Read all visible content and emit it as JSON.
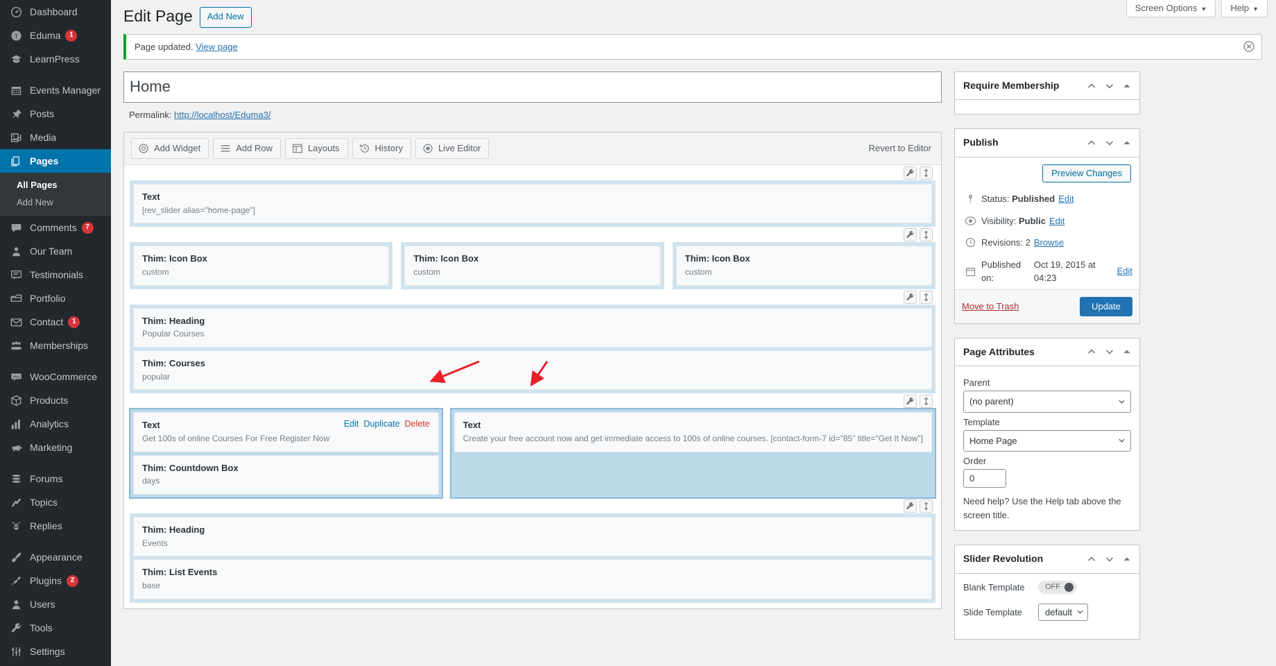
{
  "colors": {
    "accent": "#2271b1",
    "sidebar_bg": "#23282d",
    "current_menu": "#0073aa",
    "badge": "#d63638",
    "notice_green": "#00a32a",
    "delete_red": "#dc3232",
    "cell_blue": "#cfe3ef"
  },
  "sidebar": {
    "items": [
      {
        "label": "Dashboard",
        "icon": "dashboard-icon",
        "badge": ""
      },
      {
        "label": "Eduma",
        "icon": "eduma-icon",
        "badge": "1"
      },
      {
        "label": "LearnPress",
        "icon": "graduation-cap-icon",
        "badge": ""
      },
      {
        "separator": true
      },
      {
        "label": "Events Manager",
        "icon": "calendar-icon",
        "badge": ""
      },
      {
        "label": "Posts",
        "icon": "pin-icon",
        "badge": ""
      },
      {
        "label": "Media",
        "icon": "media-icon",
        "badge": ""
      },
      {
        "label": "Pages",
        "icon": "pages-icon",
        "badge": "",
        "current": true,
        "submenu": [
          {
            "label": "All Pages",
            "current": true
          },
          {
            "label": "Add New",
            "current": false
          }
        ]
      },
      {
        "label": "Comments",
        "icon": "comment-icon",
        "badge": "7"
      },
      {
        "label": "Our Team",
        "icon": "person-icon",
        "badge": ""
      },
      {
        "label": "Testimonials",
        "icon": "testimonial-icon",
        "badge": ""
      },
      {
        "label": "Portfolio",
        "icon": "portfolio-icon",
        "badge": ""
      },
      {
        "label": "Contact",
        "icon": "envelope-icon",
        "badge": "1"
      },
      {
        "label": "Memberships",
        "icon": "groups-icon",
        "badge": ""
      },
      {
        "separator": true
      },
      {
        "label": "WooCommerce",
        "icon": "woocommerce-icon",
        "badge": ""
      },
      {
        "label": "Products",
        "icon": "box-icon",
        "badge": ""
      },
      {
        "label": "Analytics",
        "icon": "chart-bar-icon",
        "badge": ""
      },
      {
        "label": "Marketing",
        "icon": "megaphone-icon",
        "badge": ""
      },
      {
        "separator": true
      },
      {
        "label": "Forums",
        "icon": "forums-icon",
        "badge": ""
      },
      {
        "label": "Topics",
        "icon": "topics-icon",
        "badge": ""
      },
      {
        "label": "Replies",
        "icon": "replies-icon",
        "badge": ""
      },
      {
        "separator": true
      },
      {
        "label": "Appearance",
        "icon": "paintbrush-icon",
        "badge": ""
      },
      {
        "label": "Plugins",
        "icon": "plug-icon",
        "badge": "2"
      },
      {
        "label": "Users",
        "icon": "users-icon",
        "badge": ""
      },
      {
        "label": "Tools",
        "icon": "wrench-icon",
        "badge": ""
      },
      {
        "label": "Settings",
        "icon": "settings-icon",
        "badge": ""
      }
    ]
  },
  "screen_meta": {
    "screen_options": "Screen Options",
    "help": "Help",
    "caret": "▼"
  },
  "header": {
    "title": "Edit Page",
    "add_new": "Add New"
  },
  "notice": {
    "text": "Page updated.",
    "link": "View page"
  },
  "post": {
    "title_value": "Home",
    "permalink_label": "Permalink:",
    "permalink_url": "http://localhost/Eduma3/"
  },
  "builder": {
    "toolbar": [
      {
        "label": "Add Widget",
        "icon": "add-widget-icon"
      },
      {
        "label": "Add Row",
        "icon": "add-row-icon"
      },
      {
        "label": "Layouts",
        "icon": "layouts-icon"
      },
      {
        "label": "History",
        "icon": "history-icon"
      },
      {
        "label": "Live Editor",
        "icon": "live-editor-icon"
      }
    ],
    "revert_label": "Revert to Editor",
    "widget_actions": {
      "edit": "Edit",
      "duplicate": "Duplicate",
      "delete": "Delete"
    },
    "rows": [
      {
        "cells": [
          {
            "widgets": [
              {
                "title": "Text",
                "desc": "[rev_slider alias=\"home-page\"]"
              }
            ]
          }
        ]
      },
      {
        "cells": [
          {
            "widgets": [
              {
                "title": "Thim: Icon Box",
                "desc": "custom"
              }
            ]
          },
          {
            "widgets": [
              {
                "title": "Thim: Icon Box",
                "desc": "custom"
              }
            ]
          },
          {
            "widgets": [
              {
                "title": "Thim: Icon Box",
                "desc": "custom"
              }
            ]
          }
        ]
      },
      {
        "cells": [
          {
            "widgets": [
              {
                "title": "Thim: Heading",
                "desc": "Popular Courses"
              },
              {
                "title": "Thim: Courses",
                "desc": "popular"
              }
            ]
          }
        ]
      },
      {
        "active": true,
        "cells": [
          {
            "active": true,
            "widgets": [
              {
                "title": "Text",
                "desc": "Get 100s of online Courses For Free Register Now",
                "show_actions": true
              },
              {
                "title": "Thim: Countdown Box",
                "desc": "days"
              }
            ]
          },
          {
            "active": true,
            "tall": true,
            "widgets": [
              {
                "title": "Text",
                "desc": "Create your free account now and get immediate access to 100s of online courses. [contact-form-7 id=\"85\" title=\"Get It Now\"]"
              }
            ]
          }
        ]
      },
      {
        "cells": [
          {
            "widgets": [
              {
                "title": "Thim: Heading",
                "desc": "Events"
              },
              {
                "title": "Thim: List Events",
                "desc": "base"
              }
            ]
          }
        ]
      }
    ]
  },
  "metaboxes": {
    "require_membership": {
      "title": "Require Membership"
    },
    "publish": {
      "title": "Publish",
      "preview_button": "Preview Changes",
      "status_label": "Status:",
      "status_value": "Published",
      "status_edit": "Edit",
      "visibility_label": "Visibility:",
      "visibility_value": "Public",
      "visibility_edit": "Edit",
      "revisions_label": "Revisions:",
      "revisions_value": "2",
      "revisions_browse": "Browse",
      "published_label": "Published on:",
      "published_value": "Oct 19, 2015 at 04:23",
      "published_edit": "Edit",
      "trash": "Move to Trash",
      "update": "Update"
    },
    "page_attributes": {
      "title": "Page Attributes",
      "parent_label": "Parent",
      "parent_value": "(no parent)",
      "template_label": "Template",
      "template_value": "Home Page",
      "order_label": "Order",
      "order_value": "0",
      "help": "Need help? Use the Help tab above the screen title."
    },
    "slider_revolution": {
      "title": "Slider Revolution",
      "blank_template_label": "Blank Template",
      "blank_template_state": "OFF",
      "slide_template_label": "Slide Template",
      "slide_template_value": "default"
    }
  }
}
